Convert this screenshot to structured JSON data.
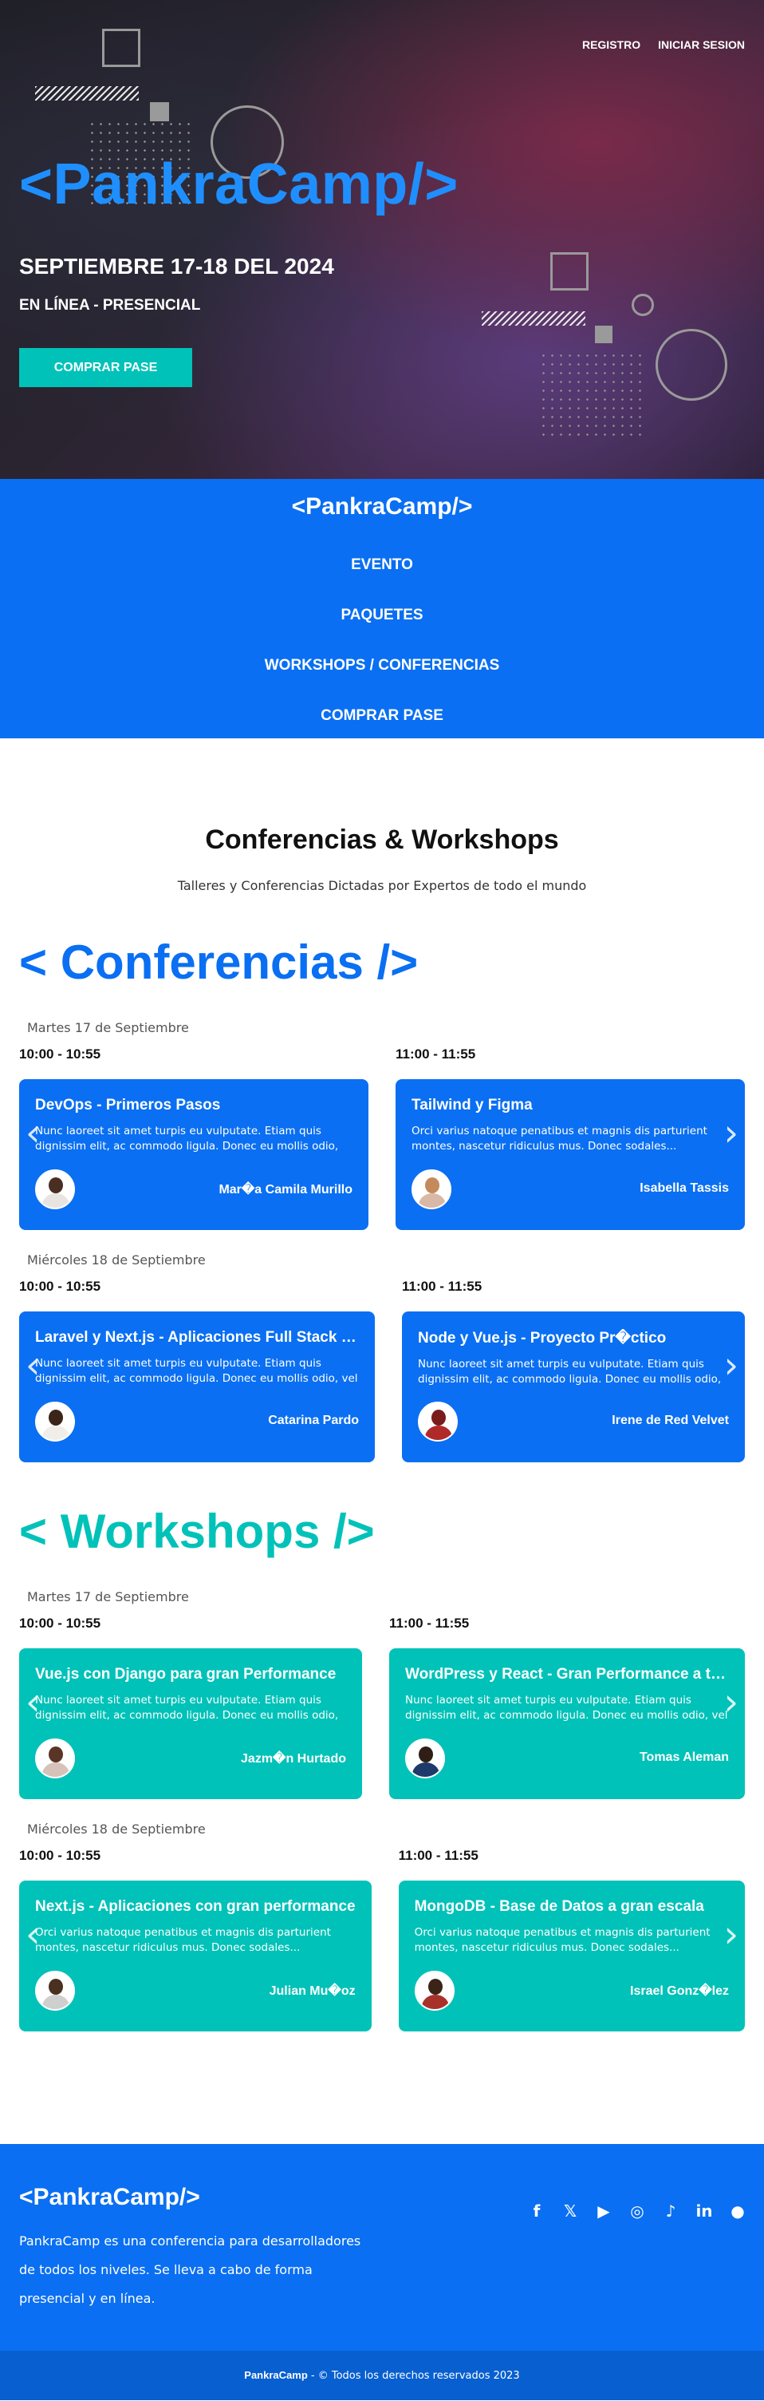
{
  "hero": {
    "links": {
      "register": "REGISTRO",
      "login": "INICIAR SESION"
    },
    "brand": "<PankraCamp/>",
    "dates": "SEPTIEMBRE 17-18 DEL 2024",
    "mode": "EN LÍNEA - PRESENCIAL",
    "buy": "COMPRAR PASE"
  },
  "nav": {
    "logo": "<PankraCamp/>",
    "items": [
      "EVENTO",
      "PAQUETES",
      "WORKSHOPS / CONFERENCIAS",
      "COMPRAR PASE"
    ]
  },
  "intro": {
    "title": "Conferencias & Workshops",
    "subtitle": "Talleres y Conferencias Dictadas por Expertos de todo el mundo"
  },
  "conferencias": {
    "title": "< Conferencias />",
    "day1": {
      "label": "Martes 17 de Septiembre",
      "slots": [
        {
          "time": "10:00 - 10:55",
          "title": "DevOps - Primeros Pasos",
          "desc": "Nunc laoreet sit amet turpis eu vulputate. Etiam quis dignissim elit, ac commodo ligula. Donec eu mollis odio, vel viverra.",
          "speaker": "Mar�a Camila Murillo"
        },
        {
          "time": "11:00 - 11:55",
          "title": "Tailwind y Figma",
          "desc": "Orci varius natoque penatibus et magnis dis parturient montes, nascetur ridiculus mus. Donec sodales...",
          "speaker": "Isabella Tassis"
        }
      ]
    },
    "day2": {
      "label": "Miércoles 18 de Septiembre",
      "slots": [
        {
          "time": "10:00 - 10:55",
          "title": "Laravel y Next.js - Aplicaciones Full Stack en Tiempo Real",
          "desc": "Nunc laoreet sit amet turpis eu vulputate. Etiam quis dignissim elit, ac commodo ligula. Donec eu mollis odio, vel viverra.",
          "speaker": "Catarina Pardo"
        },
        {
          "time": "11:00 - 11:55",
          "title": "Node y Vue.js - Proyecto Pr�ctico",
          "desc": "Nunc laoreet sit amet turpis eu vulputate. Etiam quis dignissim elit, ac commodo ligula. Donec eu mollis odio, vel viverra.",
          "speaker": "Irene de Red Velvet"
        }
      ]
    }
  },
  "workshops": {
    "title": "< Workshops />",
    "day1": {
      "label": "Martes 17 de Septiembre",
      "slots": [
        {
          "time": "10:00 - 10:55",
          "title": "Vue.js con Django para gran Performance",
          "desc": "Nunc laoreet sit amet turpis eu vulputate. Etiam quis dignissim elit, ac commodo ligula. Donec eu mollis odio, vel viverra.",
          "speaker": "Jazm�n Hurtado"
        },
        {
          "time": "11:00 - 11:55",
          "title": "WordPress y React - Gran Performance a tu sitio",
          "desc": "Nunc laoreet sit amet turpis eu vulputate. Etiam quis dignissim elit, ac commodo ligula. Donec eu mollis odio, vel viverra.",
          "speaker": "Tomas Aleman"
        }
      ]
    },
    "day2": {
      "label": "Miércoles 18 de Septiembre",
      "slots": [
        {
          "time": "10:00 - 10:55",
          "title": "Next.js - Aplicaciones con gran performance",
          "desc": "Orci varius natoque penatibus et magnis dis parturient montes, nascetur ridiculus mus. Donec sodales...",
          "speaker": "Julian Mu�oz"
        },
        {
          "time": "11:00 - 11:55",
          "title": "MongoDB - Base de Datos a gran escala",
          "desc": "Orci varius natoque penatibus et magnis dis parturient montes, nascetur ridiculus mus. Donec sodales...",
          "speaker": "Israel Gonz�lez"
        }
      ]
    }
  },
  "footer": {
    "logo": "<PankraCamp/>",
    "description": "PankraCamp es una conferencia para desarrolladores de todos los niveles. Se lleva a cabo de forma presencial y en línea.",
    "social": [
      {
        "icon": "facebook-icon",
        "glyph": "f"
      },
      {
        "icon": "twitter-icon",
        "glyph": "𝕏"
      },
      {
        "icon": "youtube-icon",
        "glyph": "▶"
      },
      {
        "icon": "instagram-icon",
        "glyph": "◎"
      },
      {
        "icon": "tiktok-icon",
        "glyph": "♪"
      },
      {
        "icon": "linkedin-icon",
        "glyph": "in"
      },
      {
        "icon": "github-icon",
        "glyph": "●"
      }
    ],
    "copyright_brand": "PankraCamp",
    "copyright_text": " - © Todos los derechos reservados 2023"
  },
  "colors": {
    "blue": "#0a6ff2",
    "teal": "#00c2b8"
  },
  "carousel": {
    "prev": "‹",
    "next": "›"
  }
}
